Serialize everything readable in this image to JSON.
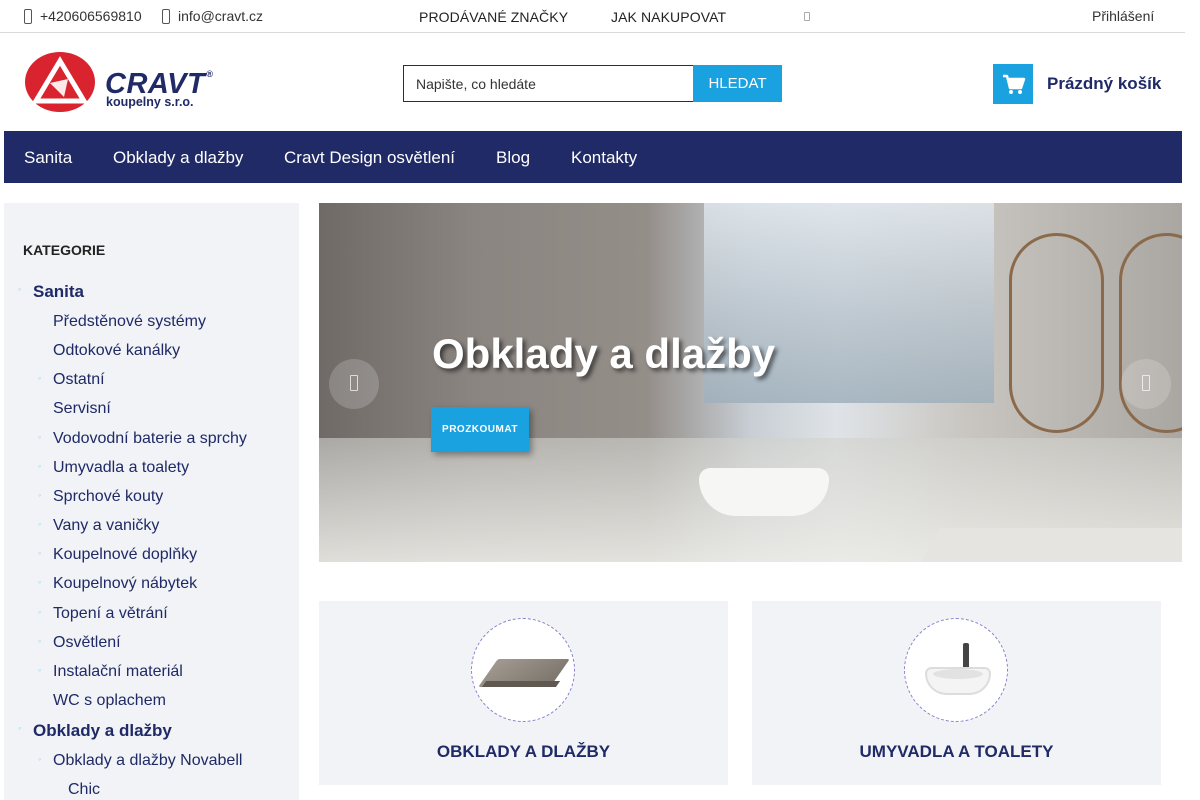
{
  "topbar": {
    "phone": "+420606569810",
    "email": "info@cravt.cz",
    "nav": [
      "PRODÁVANÉ ZNAČKY",
      "JAK NAKUPOVAT"
    ],
    "login": "Přihlášení"
  },
  "logo": {
    "brand": "CRAVT",
    "registered": "®",
    "subtitle": "koupelny s.r.o."
  },
  "search": {
    "placeholder": "Napište, co hledáte",
    "button": "HLEDAT"
  },
  "cart": {
    "label": "Prázdný košík",
    "icon": "cart-icon"
  },
  "mainnav": [
    "Sanita",
    "Obklady a dlažby",
    "Cravt Design osvětlení",
    "Blog",
    "Kontakty"
  ],
  "sidebar": {
    "heading": "KATEGORIE",
    "items": [
      "Sanita",
      "Předstěnové systémy",
      "Odtokové kanálky",
      "Ostatní",
      "Servisní",
      "Vodovodní baterie a sprchy",
      "Umyvadla a toalety",
      "Sprchové kouty",
      "Vany a vaničky",
      "Koupelnové doplňky",
      "Koupelnový nábytek",
      "Topení a větrání",
      "Osvětlení",
      "Instalační materiál",
      "WC s oplachem",
      "Obklady a dlažby",
      "Obklady a dlažby Novabell",
      "Chic"
    ]
  },
  "slider": {
    "title": "Obklady a dlažby",
    "cta": "PROZKOUMAT"
  },
  "tiles": [
    {
      "label": "OBKLADY A DLAŽBY"
    },
    {
      "label": "UMYVADLA A TOALETY"
    }
  ],
  "colors": {
    "navy": "#1f2a66",
    "accent": "#1aa1e0",
    "panel": "#f1f3f6",
    "logo_red": "#d9232e"
  }
}
